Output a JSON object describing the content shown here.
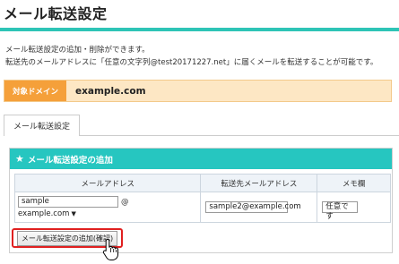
{
  "header": {
    "title": "メール転送設定"
  },
  "description": {
    "line1": "メール転送設定の追加・削除ができます。",
    "line2": "転送先のメールアドレスに「任意の文字列@test20171227.net」に届くメールを転送することが可能です。"
  },
  "target_domain": {
    "label": "対象ドメイン",
    "value": "example.com"
  },
  "tabs": [
    {
      "label": "メール転送設定"
    }
  ],
  "add_section": {
    "title": "メール転送設定の追加",
    "columns": [
      "メールアドレス",
      "転送先メールアドレス",
      "メモ欄"
    ],
    "row": {
      "local_part": "sample",
      "at": "@",
      "domain_select": "example.com",
      "forward_to": "sample2@example.com",
      "memo": "任意です"
    },
    "submit_label": "メール転送設定の追加(確認)"
  },
  "colors": {
    "accent": "#2ec4b6",
    "section_header": "#26c6c0",
    "domain_label": "#f5a03a",
    "domain_bar": "#fde7c4",
    "highlight": "#e02020"
  }
}
